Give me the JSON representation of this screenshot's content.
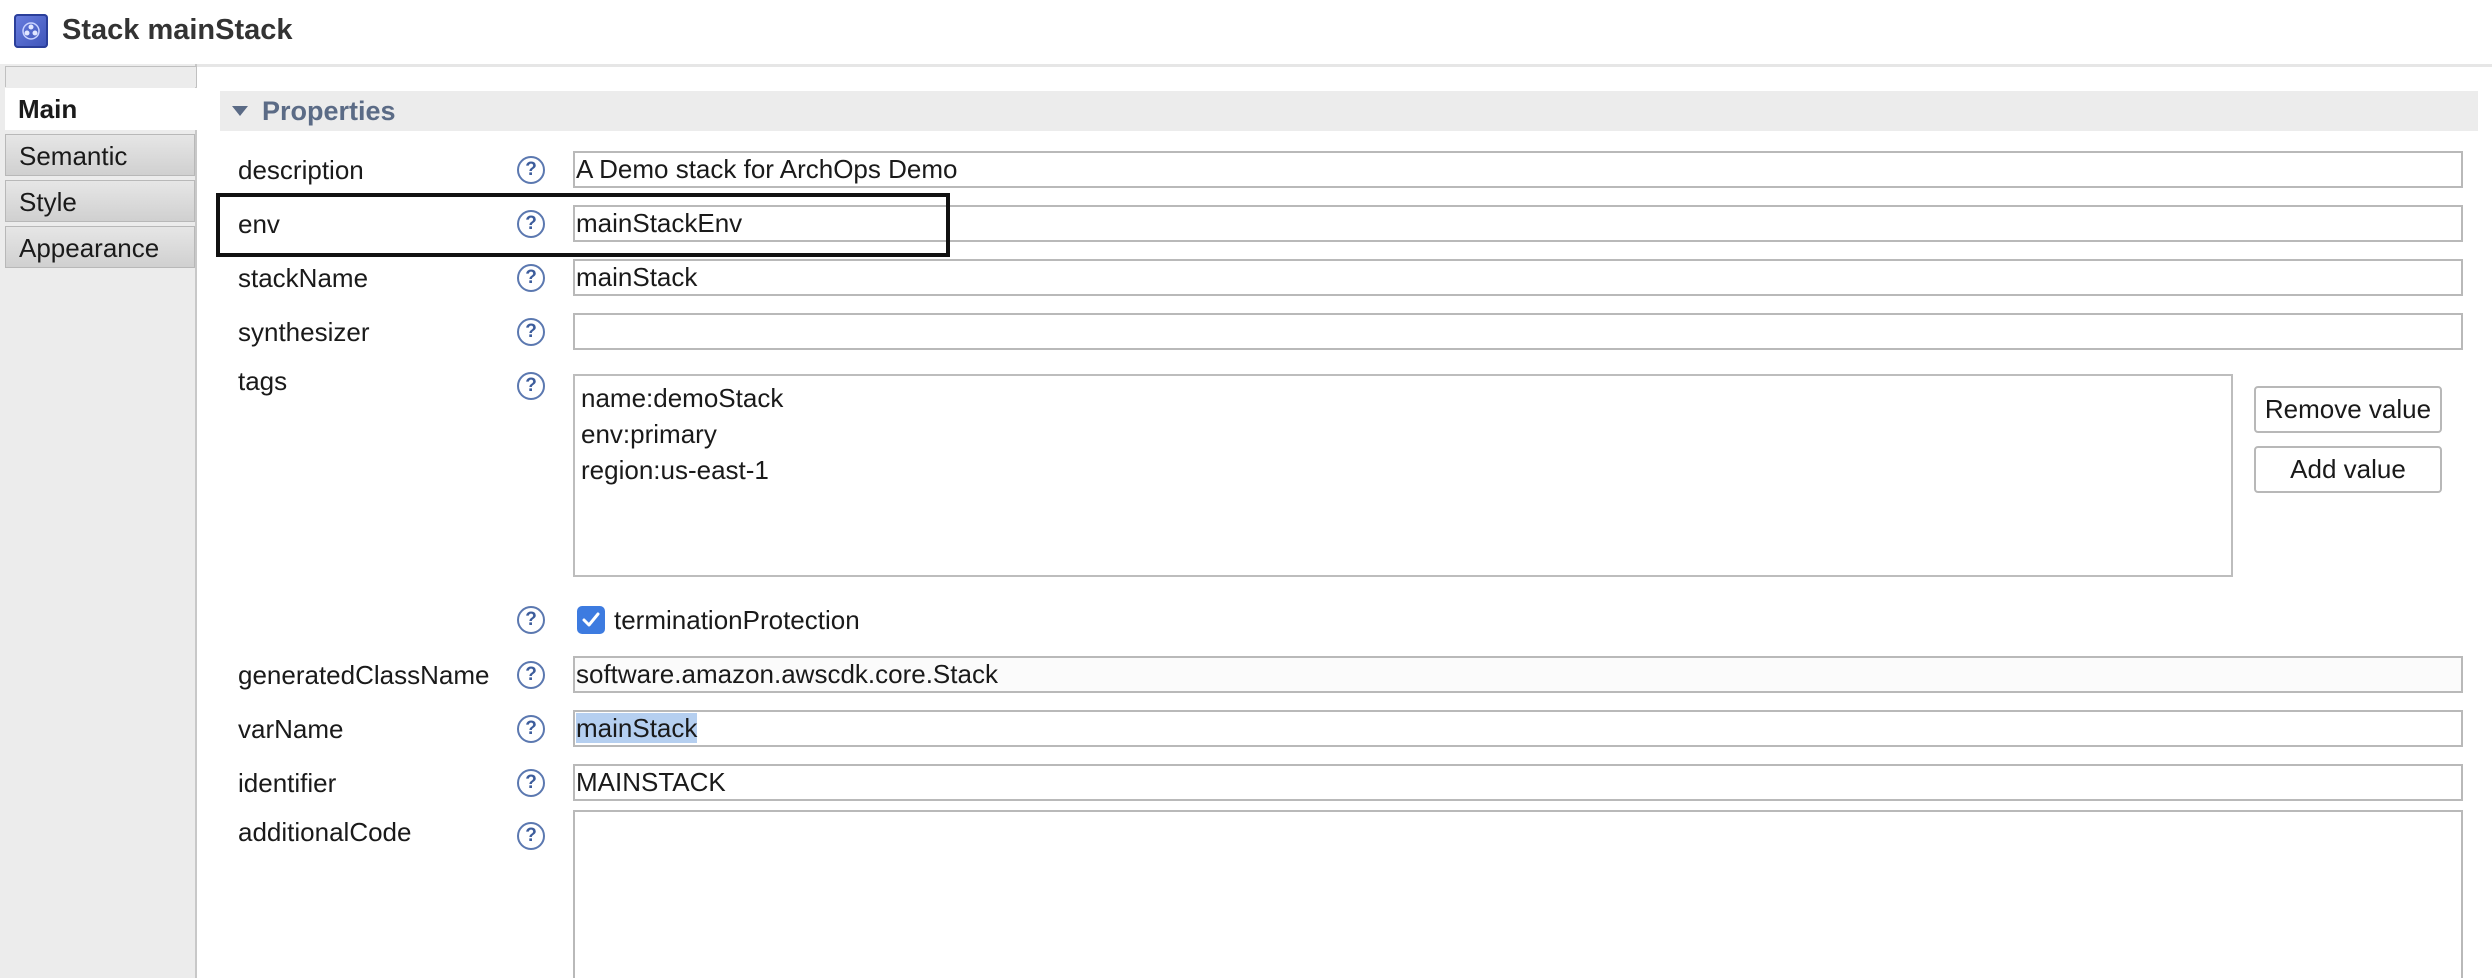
{
  "window": {
    "title": "Stack mainStack",
    "icon": "stack-app-icon"
  },
  "tabs": [
    {
      "label": "Main",
      "active": true
    },
    {
      "label": "Semantic",
      "active": false
    },
    {
      "label": "Style",
      "active": false
    },
    {
      "label": "Appearance",
      "active": false
    }
  ],
  "section": {
    "title": "Properties",
    "expanded": true
  },
  "help_glyph": "?",
  "fields": {
    "description": {
      "label": "description",
      "value": "A Demo stack for ArchOps Demo"
    },
    "env": {
      "label": "env",
      "value": "mainStackEnv"
    },
    "stackName": {
      "label": "stackName",
      "value": "mainStack"
    },
    "synthesizer": {
      "label": "synthesizer",
      "value": ""
    },
    "tags": {
      "label": "tags",
      "values": [
        "name:demoStack",
        "env:primary",
        "region:us-east-1"
      ]
    },
    "terminationProtection": {
      "label": "terminationProtection",
      "checked": true
    },
    "generatedClassName": {
      "label": "generatedClassName",
      "value": "software.amazon.awscdk.core.Stack"
    },
    "varName": {
      "label": "varName",
      "value": "mainStack"
    },
    "identifier": {
      "label": "identifier",
      "value": "MAINSTACK"
    },
    "additionalCode": {
      "label": "additionalCode",
      "value": ""
    }
  },
  "buttons": {
    "remove_value": "Remove value",
    "add_value": "Add value"
  },
  "colors": {
    "accent": "#3d7be0",
    "section_title": "#5b6b86",
    "selection": "#b5cff0"
  }
}
